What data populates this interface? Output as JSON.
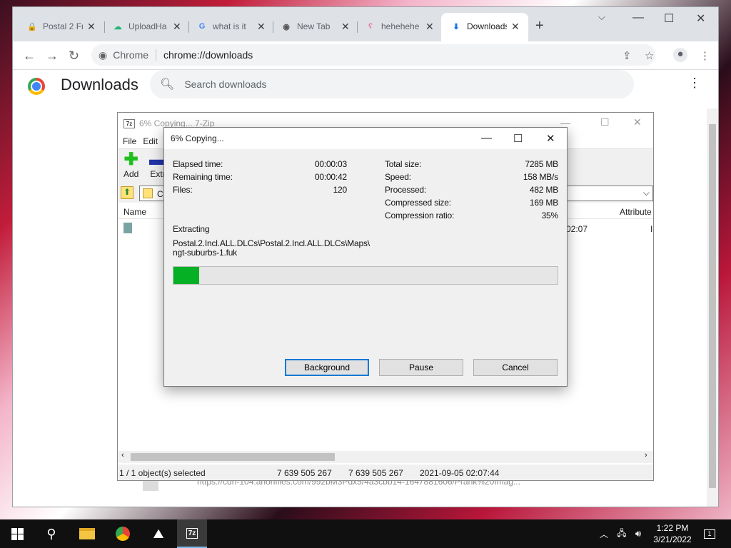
{
  "browser": {
    "tabs": [
      {
        "title": "Postal 2 Fr",
        "icon": "lock-red-icon"
      },
      {
        "title": "UploadHa",
        "icon": "upload-cloud-icon"
      },
      {
        "title": "what is it",
        "icon": "google-g-icon"
      },
      {
        "title": "New Tab",
        "icon": "chrome-icon"
      },
      {
        "title": "hehehehe",
        "icon": "pink-bunny-icon"
      },
      {
        "title": "Downloads",
        "icon": "download-icon"
      }
    ],
    "omnibox": {
      "site_label": "Chrome",
      "url": "chrome://downloads"
    }
  },
  "downloads": {
    "title": "Downloads",
    "search_placeholder": "Search downloads",
    "item_url": "https://cdn-104.anonfiles.com/992bM3Pdx5/4a3cbb14-1647881606/Prank%20Imag..."
  },
  "sevenzip": {
    "title": "6% Copying... 7-Zip",
    "menu": [
      "File",
      "Edit"
    ],
    "toolbar": [
      "Add",
      "Extr"
    ],
    "address_fragment": "C",
    "columns": {
      "name": "Name",
      "attributes": "Attribute"
    },
    "row_fragments": {
      "modified": "02:07",
      "attr": "I"
    },
    "status": {
      "selection": "1 / 1 object(s) selected",
      "size": "7 639 505 267",
      "packed": "7 639 505 267",
      "modified": "2021-09-05 02:07:44"
    }
  },
  "dialog": {
    "title": "6% Copying...",
    "left_stats": [
      {
        "label": "Elapsed time:",
        "value": "00:00:03"
      },
      {
        "label": "Remaining time:",
        "value": "00:00:42"
      },
      {
        "label": "Files:",
        "value": "120"
      }
    ],
    "right_stats": [
      {
        "label": "Total size:",
        "value": "7285 MB"
      },
      {
        "label": "Speed:",
        "value": "158 MB/s"
      },
      {
        "label": "Processed:",
        "value": "482 MB"
      },
      {
        "label": "Compressed size:",
        "value": "169 MB"
      },
      {
        "label": "Compression ratio:",
        "value": "35%"
      }
    ],
    "operation": "Extracting",
    "path_line1": "Postal.2.Incl.ALL.DLCs\\Postal.2.Incl.ALL.DLCs\\Maps\\",
    "path_line2": "ngt-suburbs-1.fuk",
    "progress": 0.066,
    "buttons": {
      "background": "Background",
      "pause": "Pause",
      "cancel": "Cancel"
    }
  },
  "taskbar": {
    "time": "1:22 PM",
    "date": "3/21/2022",
    "notification_count": "1",
    "pinned": [
      "search-icon",
      "file-explorer-icon",
      "chrome-icon",
      "photos-icon",
      "7zip-icon"
    ]
  },
  "colors": {
    "progress_fill": "#06b025",
    "accent": "#0078d7"
  }
}
